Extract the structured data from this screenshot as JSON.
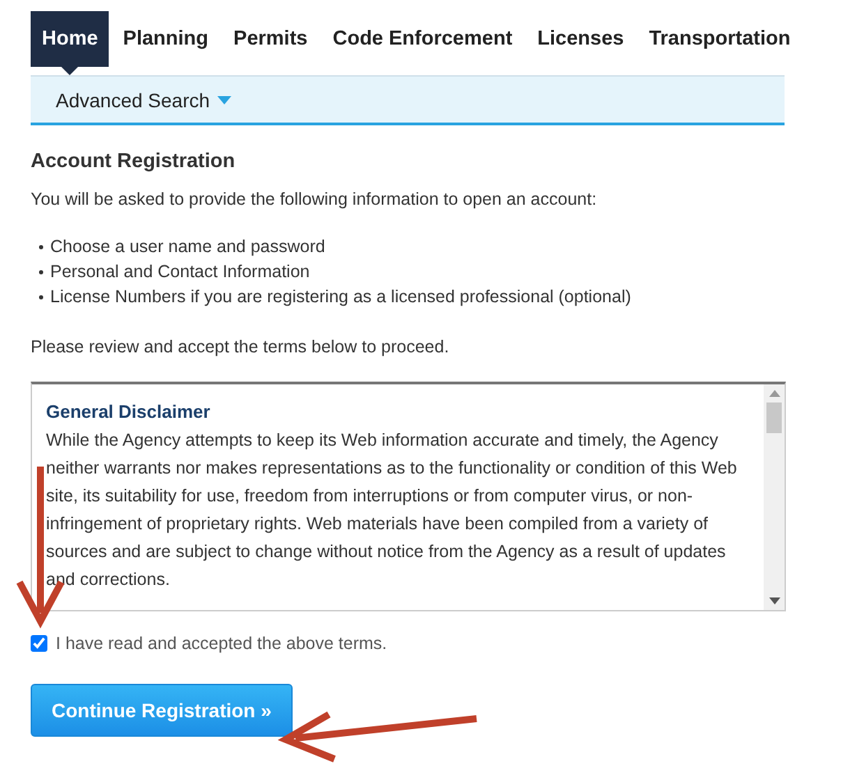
{
  "tabs": [
    {
      "label": "Home",
      "selected": true
    },
    {
      "label": "Planning",
      "selected": false
    },
    {
      "label": "Permits",
      "selected": false
    },
    {
      "label": "Code Enforcement",
      "selected": false
    },
    {
      "label": "Licenses",
      "selected": false
    },
    {
      "label": "Transportation",
      "selected": false
    }
  ],
  "subnav": {
    "label": "Advanced Search"
  },
  "heading": "Account Registration",
  "intro": "You will be asked to provide the following information to open an account:",
  "requirements": [
    "Choose a user name and password",
    "Personal and Contact Information",
    "License Numbers if you are registering as a licensed professional (optional)"
  ],
  "review_note": "Please review and accept the terms below to proceed.",
  "disclaimer": {
    "title": "General Disclaimer",
    "body": "While the Agency attempts to keep its Web information accurate and timely, the Agency neither warrants nor makes representations as to the functionality or condition of this Web site, its suitability for use, freedom from interruptions or from computer virus, or non-infringement of proprietary rights. Web materials have been compiled from a variety of sources and are subject to change without notice from the Agency as a result of updates and corrections."
  },
  "terms": {
    "label": "I have read and accepted the above terms.",
    "checked": true
  },
  "button": {
    "label": "Continue Registration »"
  }
}
